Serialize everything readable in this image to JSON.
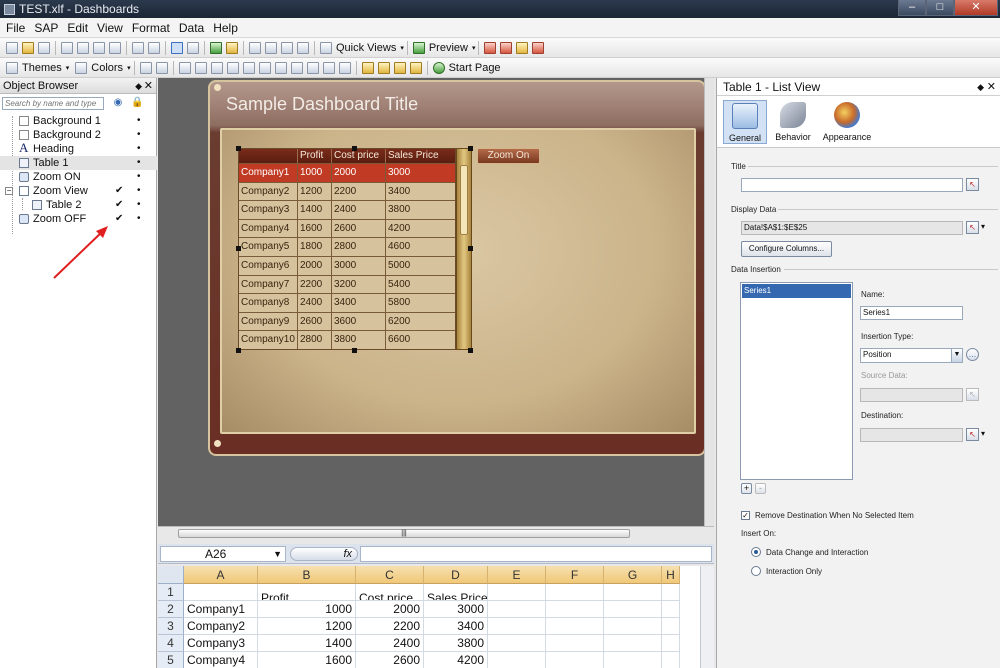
{
  "window": {
    "title": "TEST.xlf - Dashboards",
    "min_glyph": "–",
    "max_glyph": "□",
    "close_glyph": "✕"
  },
  "menu": [
    "File",
    "SAP",
    "Edit",
    "View",
    "Format",
    "Data",
    "Help"
  ],
  "toolbar1": {
    "quick_views": "Quick Views",
    "preview": "Preview"
  },
  "toolbar2": {
    "themes": "Themes",
    "colors": "Colors",
    "start_page": "Start Page"
  },
  "object_browser": {
    "title": "Object Browser",
    "search_placeholder": "Search by name and type",
    "items": [
      {
        "label": "Background 1",
        "check": "",
        "dot": "•"
      },
      {
        "label": "Background 2",
        "check": "",
        "dot": "•"
      },
      {
        "label": "Heading",
        "check": "",
        "dot": "•"
      },
      {
        "label": "Table 1",
        "check": "",
        "dot": "•"
      },
      {
        "label": "Zoom ON",
        "check": "",
        "dot": "•"
      },
      {
        "label": "Zoom View",
        "check": "✔",
        "dot": "•"
      },
      {
        "label": "Table 2",
        "check": "✔",
        "dot": "•"
      },
      {
        "label": "Zoom OFF",
        "check": "✔",
        "dot": "•"
      }
    ]
  },
  "dashboard": {
    "title": "Sample Dashboard Title",
    "zoom_button": "Zoom On",
    "table_headers": [
      "",
      "Profit",
      "Cost price",
      "Sales Price"
    ],
    "table_rows": [
      [
        "Company1",
        "1000",
        "2000",
        "3000"
      ],
      [
        "Company2",
        "1200",
        "2200",
        "3400"
      ],
      [
        "Company3",
        "1400",
        "2400",
        "3800"
      ],
      [
        "Company4",
        "1600",
        "2600",
        "4200"
      ],
      [
        "Company5",
        "1800",
        "2800",
        "4600"
      ],
      [
        "Company6",
        "2000",
        "3000",
        "5000"
      ],
      [
        "Company7",
        "2200",
        "3200",
        "5400"
      ],
      [
        "Company8",
        "2400",
        "3400",
        "5800"
      ],
      [
        "Company9",
        "2600",
        "3600",
        "6200"
      ],
      [
        "Company10",
        "2800",
        "3800",
        "6600"
      ]
    ]
  },
  "spreadsheet": {
    "name_box": "A26",
    "fx_label": "fx",
    "columns": [
      "A",
      "B",
      "C",
      "D",
      "E",
      "F",
      "G",
      "H"
    ],
    "rows": [
      {
        "n": "1",
        "cells": [
          "",
          "Profit",
          "Cost price",
          "Sales Price"
        ]
      },
      {
        "n": "2",
        "cells": [
          "Company1",
          "1000",
          "2000",
          "3000"
        ]
      },
      {
        "n": "3",
        "cells": [
          "Company2",
          "1200",
          "2200",
          "3400"
        ]
      },
      {
        "n": "4",
        "cells": [
          "Company3",
          "1400",
          "2400",
          "3800"
        ]
      },
      {
        "n": "5",
        "cells": [
          "Company4",
          "1600",
          "2600",
          "4200"
        ]
      }
    ]
  },
  "properties": {
    "title": "Table 1 - List View",
    "tabs": [
      "General",
      "Behavior",
      "Appearance"
    ],
    "title_label": "Title",
    "title_value": "",
    "display_data_label": "Display Data",
    "display_data_value": "Data!$A$1:$E$25",
    "configure_columns": "Configure Columns...",
    "data_insertion_label": "Data Insertion",
    "series": [
      "Series1"
    ],
    "name_label": "Name:",
    "name_value": "Series1",
    "insertion_type_label": "Insertion Type:",
    "insertion_type_value": "Position",
    "source_data_label": "Source Data:",
    "destination_label": "Destination:",
    "add_glyph": "+",
    "remove_glyph": "-",
    "remove_destination_label": "Remove Destination When No Selected Item",
    "insert_on_label": "Insert On:",
    "insert_on_options": [
      "Data Change and Interaction",
      "Interaction Only"
    ],
    "insert_on_selected": "Data Change and Interaction"
  }
}
